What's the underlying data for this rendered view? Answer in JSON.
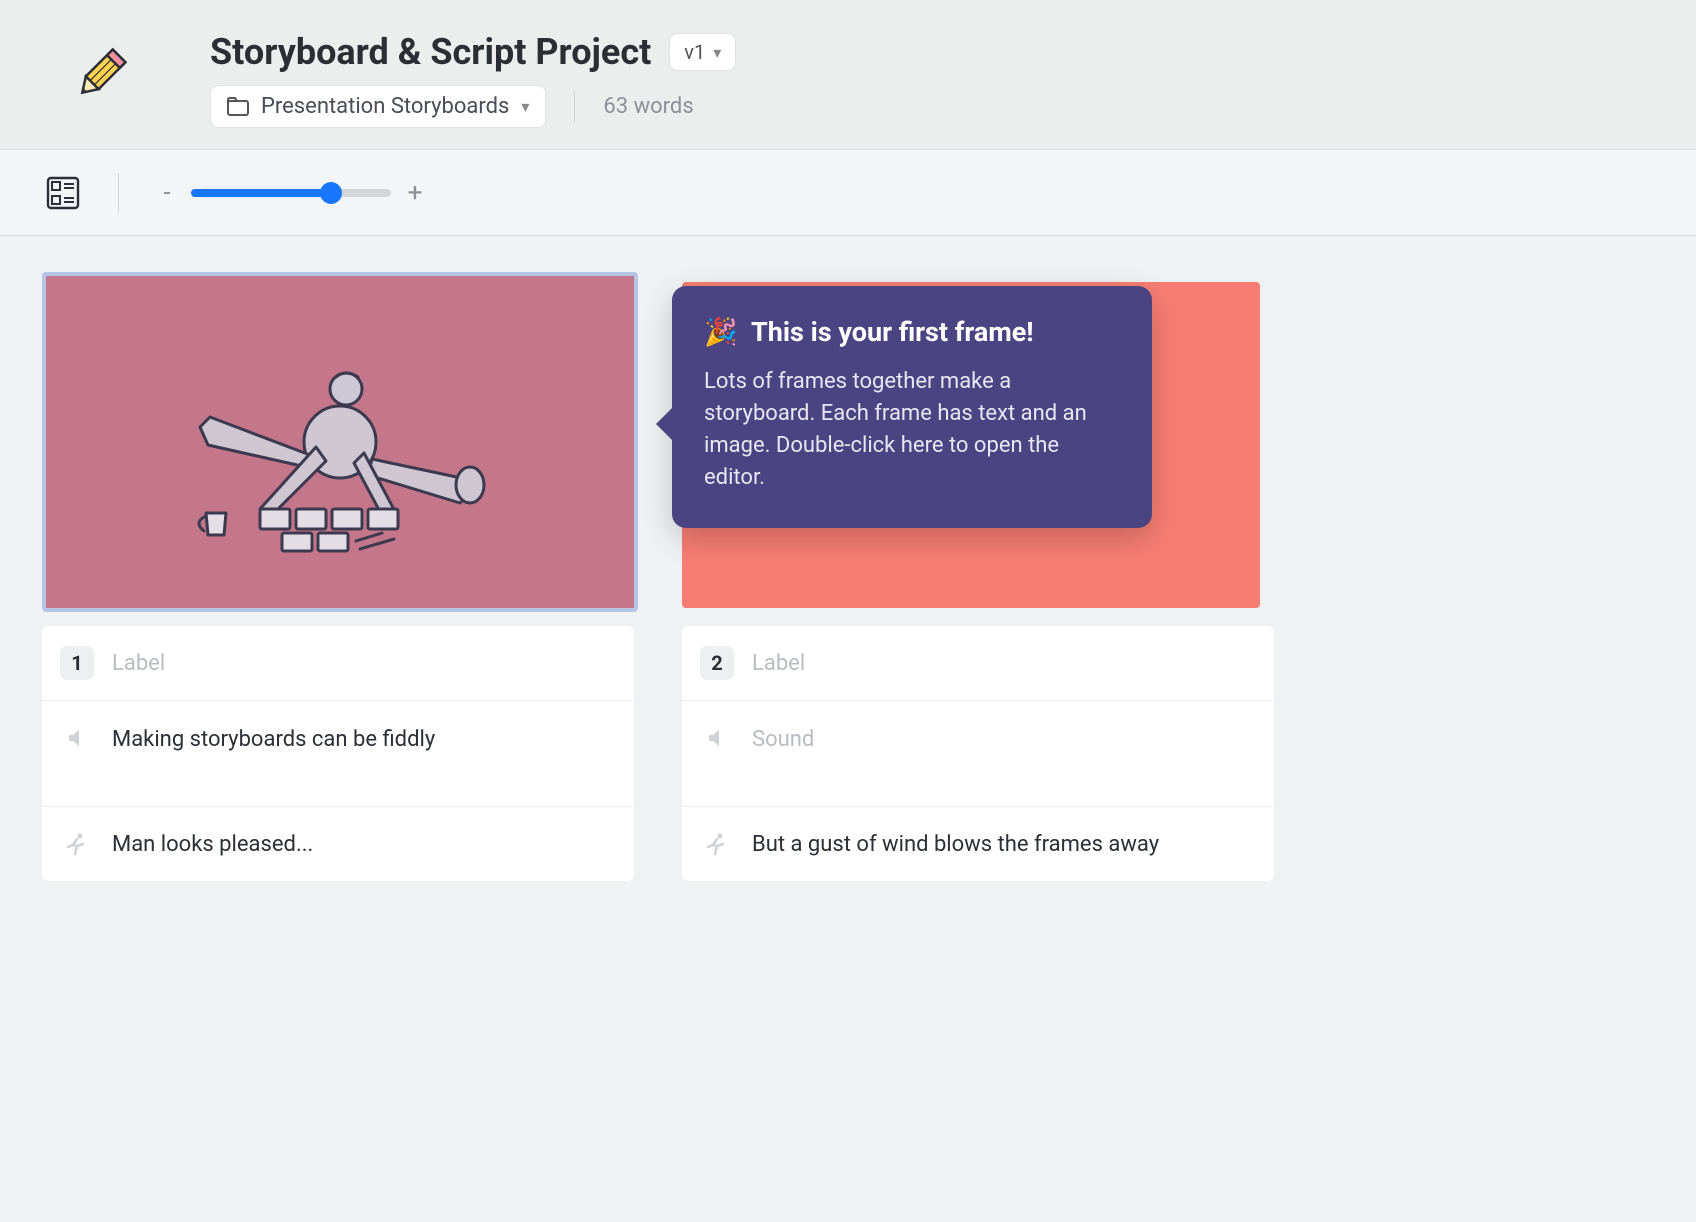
{
  "header": {
    "title": "Storyboard & Script Project",
    "version_label": "v1",
    "folder_label": "Presentation Storyboards",
    "word_count": "63 words"
  },
  "toolbar": {
    "zoom_pct": 72
  },
  "tooltip": {
    "emoji": "🎉",
    "title": "This is your first frame!",
    "body": "Lots of frames together make a storyboard. Each frame has text and an image. Double-click here to open the editor."
  },
  "frames": [
    {
      "number": "1",
      "label_placeholder": "Label",
      "sound": "Making storyboards can be fiddly",
      "action": "Man looks pleased..."
    },
    {
      "number": "2",
      "label_placeholder": "Label",
      "sound_placeholder": "Sound",
      "action": "But a gust of wind blows the frames away"
    }
  ]
}
